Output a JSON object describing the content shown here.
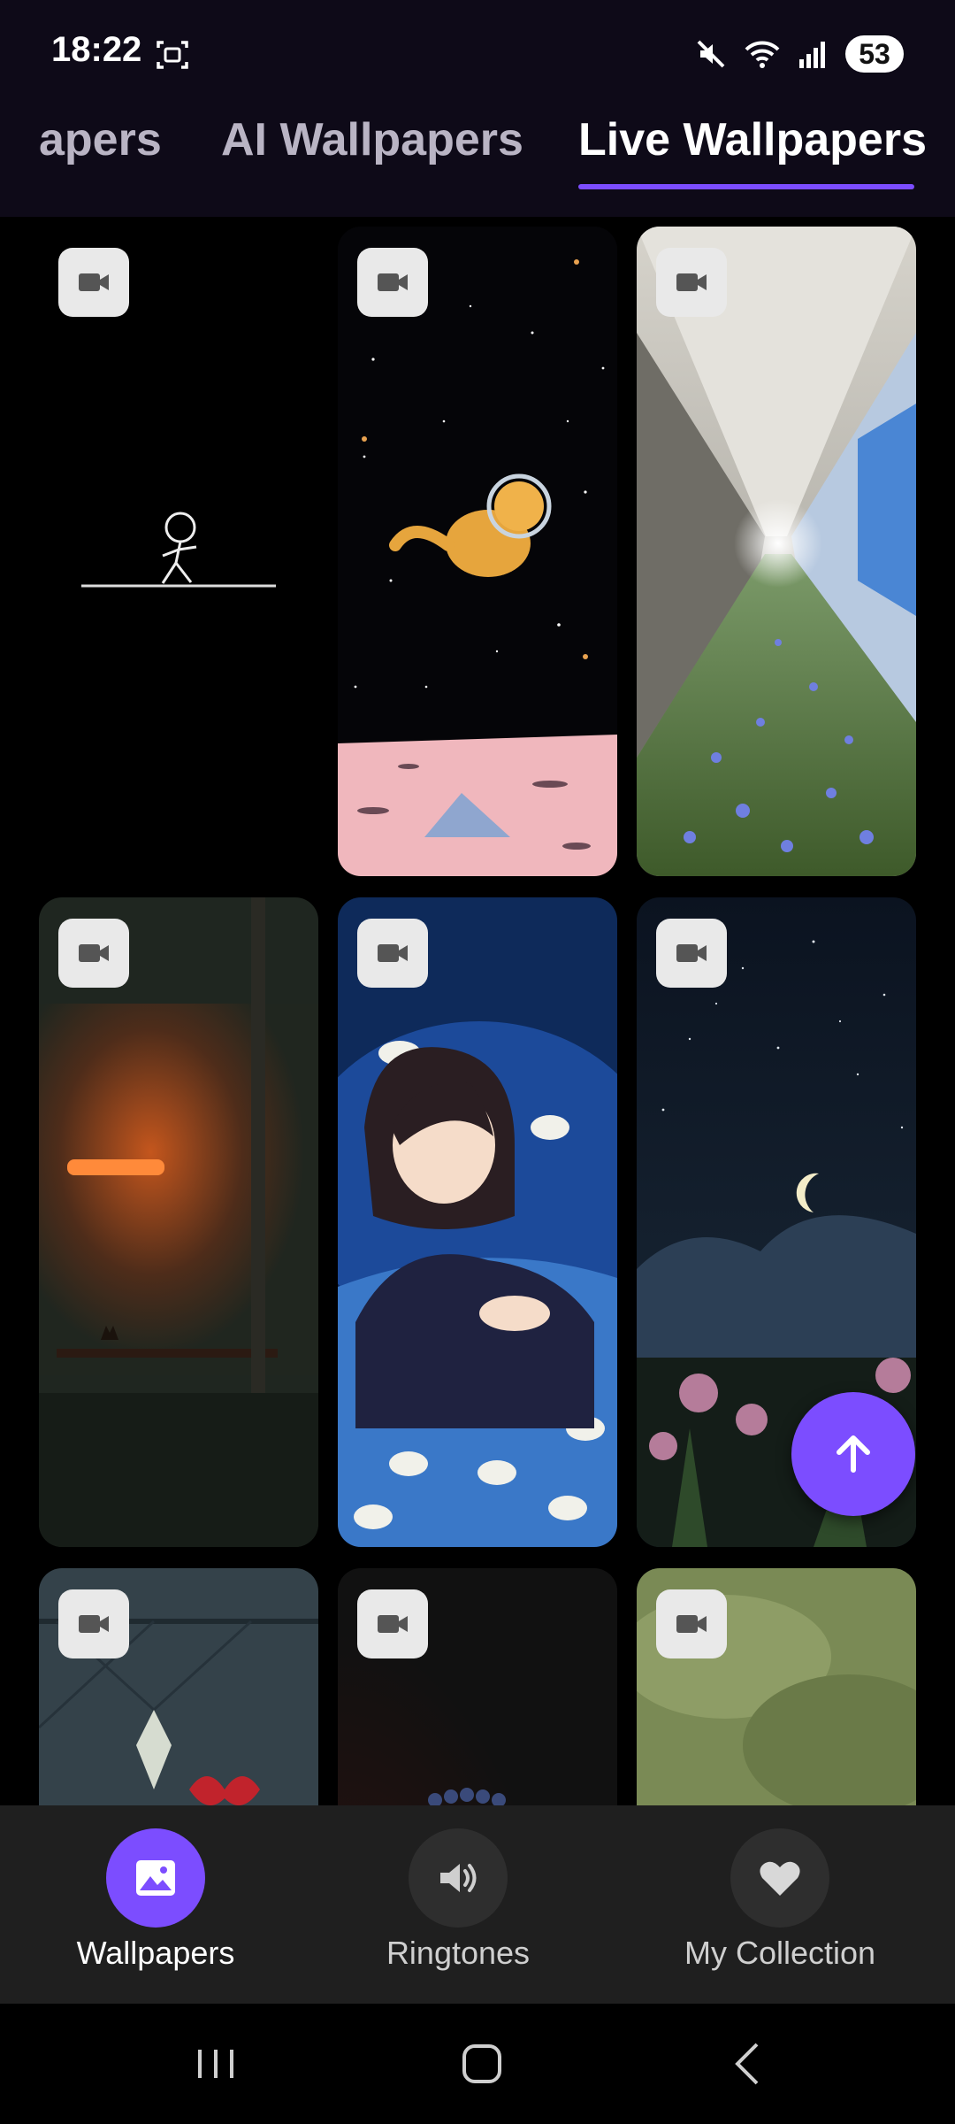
{
  "status_bar": {
    "time": "18:22",
    "battery": "53",
    "icons": [
      "screenshot-icon",
      "mute-icon",
      "wifi-icon",
      "signal-icon",
      "battery-icon"
    ]
  },
  "tabs": [
    {
      "label": "Wallpapers",
      "visible_text": "apers"
    },
    {
      "label": "AI Wallpapers"
    },
    {
      "label": "Live Wallpapers",
      "selected": true
    }
  ],
  "grid": {
    "badge_icon": "video-camera-icon",
    "items": [
      {
        "name": "stick-figure"
      },
      {
        "name": "space-cat"
      },
      {
        "name": "flower-corridor"
      },
      {
        "name": "orange-lamp-room"
      },
      {
        "name": "girl-in-bed"
      },
      {
        "name": "moon-night-flowers"
      },
      {
        "name": "window-bow"
      },
      {
        "name": "dark-blueberries"
      },
      {
        "name": "green-clouds"
      }
    ]
  },
  "fab": {
    "icon": "arrow-up-icon"
  },
  "bottom_nav": [
    {
      "label": "Wallpapers",
      "icon": "image-icon",
      "active": true
    },
    {
      "label": "Ringtones",
      "icon": "speaker-icon"
    },
    {
      "label": "My Collection",
      "icon": "heart-icon"
    }
  ],
  "colors": {
    "accent": "#7c4dff",
    "header_bg": "#0e0a18",
    "nav_bg": "#1f1f1f"
  }
}
